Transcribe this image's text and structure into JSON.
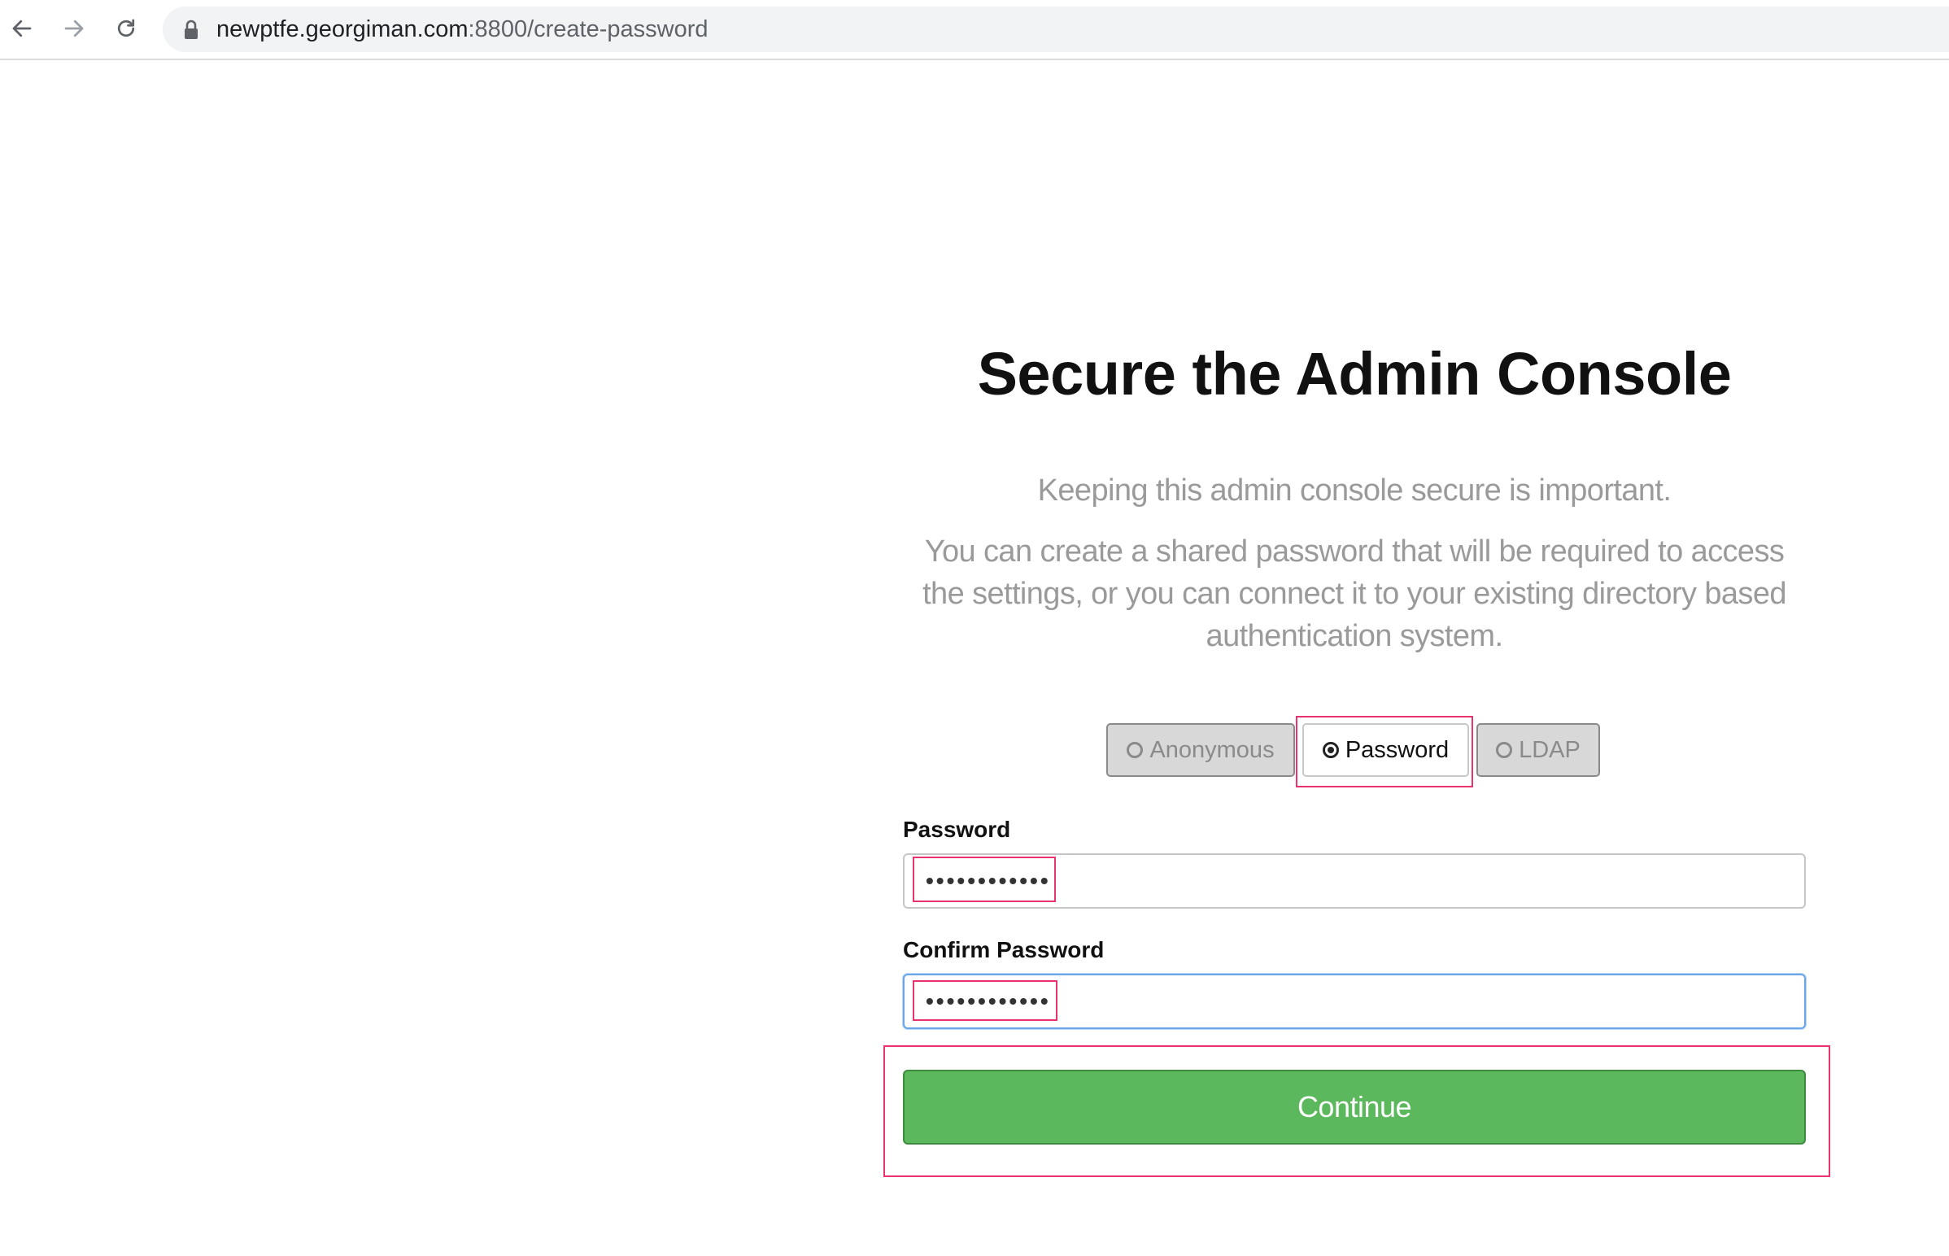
{
  "browser": {
    "url_host": "newptfe.georgiman.com",
    "url_rest": ":8800/create-password",
    "icons": {
      "back": "arrow-left-icon",
      "forward": "arrow-right-icon",
      "reload": "reload-icon",
      "lock": "lock-icon"
    }
  },
  "page": {
    "title": "Secure the Admin Console",
    "intro": "Keeping this admin console secure is important.",
    "description": "You can create a shared password that will be required to access the settings, or you can connect it to your existing directory based authentication system."
  },
  "auth_options": {
    "selected": "Password",
    "anonymous": "Anonymous",
    "password": "Password",
    "ldap": "LDAP"
  },
  "form": {
    "password_label": "Password",
    "password_value": "••••••••••••",
    "confirm_label": "Confirm Password",
    "confirm_value": "••••••••••••",
    "continue_label": "Continue"
  },
  "colors": {
    "continue_button": "#5cb85c",
    "highlight": "#e8336d",
    "focus_border": "#6aa6e8"
  }
}
